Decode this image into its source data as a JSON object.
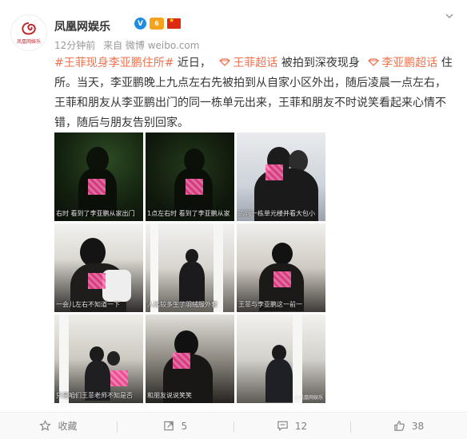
{
  "post": {
    "author": "凤凰网娱乐",
    "avatar_label": "凤凰网娱乐",
    "time": "12分钟前",
    "source": "来自 微博 weibo.com",
    "topic": "#王菲现身李亚鹏住所#",
    "text_1": "近日，",
    "super_topic_1": "王菲超话",
    "text_2": "被拍到深夜现身",
    "super_topic_2": "李亚鹏超话",
    "text_3": "住所。当天，李亚鹏晚上九点左右先被拍到从自家小区外出，随后凌晨一点左右，王菲和朋友从李亚鹏出门的同一栋单元出来，王菲和朋友不时说笑看起来心情不错，随后与朋友告别回家。",
    "accent_color": "#eb7350"
  },
  "photos": [
    {
      "caption": "右时  看到了李亚鹏从家出门"
    },
    {
      "caption": "1点左右时  看到了李亚鹏从家"
    },
    {
      "caption": "的同一栋单元楼并看大包小"
    },
    {
      "caption": "一会儿左右不知道一下"
    },
    {
      "caption": "人比较多生了羽绒服外套"
    },
    {
      "caption": "王菲与李亚鹏这一前一"
    },
    {
      "caption": "只是咱们王菲老师不知是否"
    },
    {
      "caption": "和朋友说说笑笑"
    },
    {
      "caption": "",
      "watermark": "@凤凰网娱乐"
    }
  ],
  "footer": {
    "favorite_label": "收藏",
    "repost_count": "5",
    "comment_count": "12",
    "like_count": "38"
  }
}
